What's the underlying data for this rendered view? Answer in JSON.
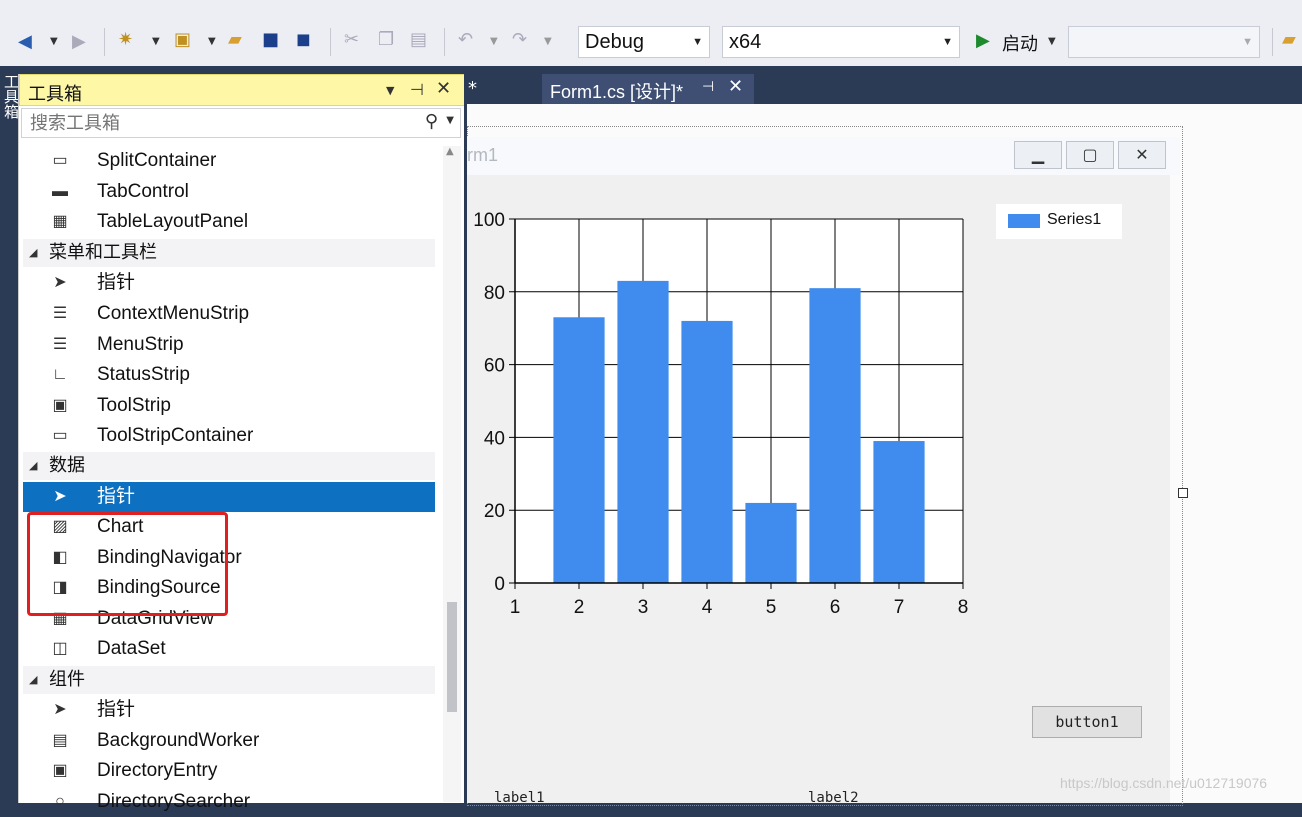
{
  "toolbar": {
    "config_combo": "Debug",
    "platform_combo": "x64",
    "start_label": "启动",
    "target_combo": ""
  },
  "side_strip": {
    "label": "工具箱"
  },
  "toolbox": {
    "title": "工具箱",
    "search_placeholder": "搜索工具箱",
    "items": [
      {
        "kind": "item",
        "icon": "split-container-icon",
        "glyph": "▭",
        "label": "SplitContainer"
      },
      {
        "kind": "item",
        "icon": "tab-control-icon",
        "glyph": "▬",
        "label": "TabControl"
      },
      {
        "kind": "item",
        "icon": "table-layout-icon",
        "glyph": "▦",
        "label": "TableLayoutPanel"
      },
      {
        "kind": "category",
        "label": "菜单和工具栏"
      },
      {
        "kind": "item",
        "icon": "pointer-icon",
        "glyph": "➤",
        "label": "指针"
      },
      {
        "kind": "item",
        "icon": "context-menu-icon",
        "glyph": "☰",
        "label": "ContextMenuStrip"
      },
      {
        "kind": "item",
        "icon": "menu-strip-icon",
        "glyph": "☰",
        "label": "MenuStrip"
      },
      {
        "kind": "item",
        "icon": "status-strip-icon",
        "glyph": "∟",
        "label": "StatusStrip"
      },
      {
        "kind": "item",
        "icon": "tool-strip-icon",
        "glyph": "▣",
        "label": "ToolStrip"
      },
      {
        "kind": "item",
        "icon": "tool-strip-container-icon",
        "glyph": "▭",
        "label": "ToolStripContainer"
      },
      {
        "kind": "category",
        "label": "数据"
      },
      {
        "kind": "item",
        "icon": "pointer-icon",
        "glyph": "➤",
        "label": "指针",
        "selected": true
      },
      {
        "kind": "item",
        "icon": "chart-icon",
        "glyph": "▨",
        "label": "Chart"
      },
      {
        "kind": "item",
        "icon": "binding-navigator-icon",
        "glyph": "◧",
        "label": "BindingNavigator"
      },
      {
        "kind": "item",
        "icon": "binding-source-icon",
        "glyph": "◨",
        "label": "BindingSource"
      },
      {
        "kind": "item",
        "icon": "datagridview-icon",
        "glyph": "▦",
        "label": "DataGridView"
      },
      {
        "kind": "item",
        "icon": "dataset-icon",
        "glyph": "◫",
        "label": "DataSet"
      },
      {
        "kind": "category",
        "label": "组件"
      },
      {
        "kind": "item",
        "icon": "pointer-icon",
        "glyph": "➤",
        "label": "指针"
      },
      {
        "kind": "item",
        "icon": "background-worker-icon",
        "glyph": "▤",
        "label": "BackgroundWorker"
      },
      {
        "kind": "item",
        "icon": "directory-entry-icon",
        "glyph": "▣",
        "label": "DirectoryEntry"
      },
      {
        "kind": "item",
        "icon": "directory-searcher-icon",
        "glyph": "○",
        "label": "DirectorySearcher"
      }
    ]
  },
  "tabs": {
    "prev_tab_fragment": "*",
    "active_tab": "Form1.cs [设计]*"
  },
  "form": {
    "title_fragment": "rm1",
    "button1": "button1",
    "label1": "label1",
    "label2": "label2"
  },
  "watermark": "https://blog.csdn.net/u012719076",
  "colors": {
    "accent": "#0e70c0",
    "series": "#3f8cee",
    "highlight": "#e02020"
  },
  "chart_data": {
    "type": "bar",
    "x": [
      2,
      3,
      4,
      5,
      6,
      7
    ],
    "series": [
      {
        "name": "Series1",
        "values": [
          73,
          83,
          72,
          22,
          81,
          39
        ]
      }
    ],
    "xlim": [
      1,
      8
    ],
    "ylim": [
      0,
      100
    ],
    "xticks": [
      "1",
      "2",
      "3",
      "4",
      "5",
      "6",
      "7",
      "8"
    ],
    "yticks": [
      "0",
      "20",
      "40",
      "60",
      "80",
      "100"
    ],
    "grid": true,
    "legend": "top-right"
  }
}
